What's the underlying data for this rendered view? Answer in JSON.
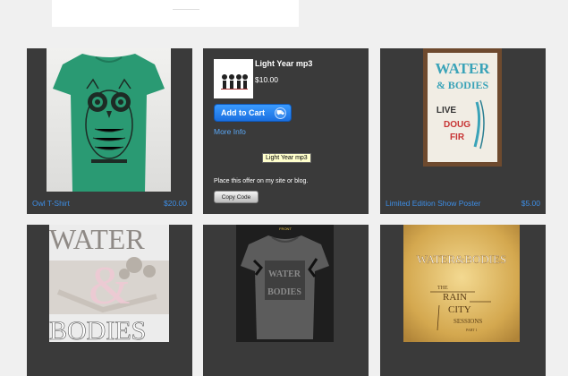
{
  "products": [
    {
      "name": "Owl T-Shirt",
      "price": "$20.00",
      "image_icon": "owl-shirt-photo"
    },
    {
      "name": "Light Year mp3",
      "price": "$10.00",
      "image_icon": "album-thumbnail"
    },
    {
      "name": "Limited Edition Show Poster",
      "price": "$5.00",
      "image_icon": "show-poster"
    }
  ],
  "widget": {
    "title": "Light Year mp3",
    "price": "$10.00",
    "cart_label": "Add to Cart",
    "more_info": "More Info",
    "tooltip": "Light Year mp3",
    "place_text": "Place this offer on my site or blog.",
    "copy_label": "Copy Code"
  },
  "poster_art": {
    "line1": "WATER",
    "line2": "& BODIES",
    "line3": "LIVE",
    "line4": "DOUG",
    "line5": "FIR"
  },
  "bottom_art": {
    "cover1_top": "WATER",
    "cover1_amp": "&",
    "cover1_bottom": "BODIES",
    "shirt_label": "FRONT",
    "shirt_print1": "WATER",
    "shirt_print2": "BODIES",
    "cover3_title": "WATER&BODIES",
    "cover3_sub1": "THE",
    "cover3_sub2": "RAIN",
    "cover3_sub3": "CITY",
    "cover3_sub4": "SESSIONS",
    "cover3_sub5": "PART 1"
  },
  "colors": {
    "tile_bg": "#3a3a3a",
    "page_bg": "#f0f0f0",
    "link": "#3d8ee6",
    "cart_button": "#1a6fe0",
    "shirt_green": "#2a9a73"
  }
}
